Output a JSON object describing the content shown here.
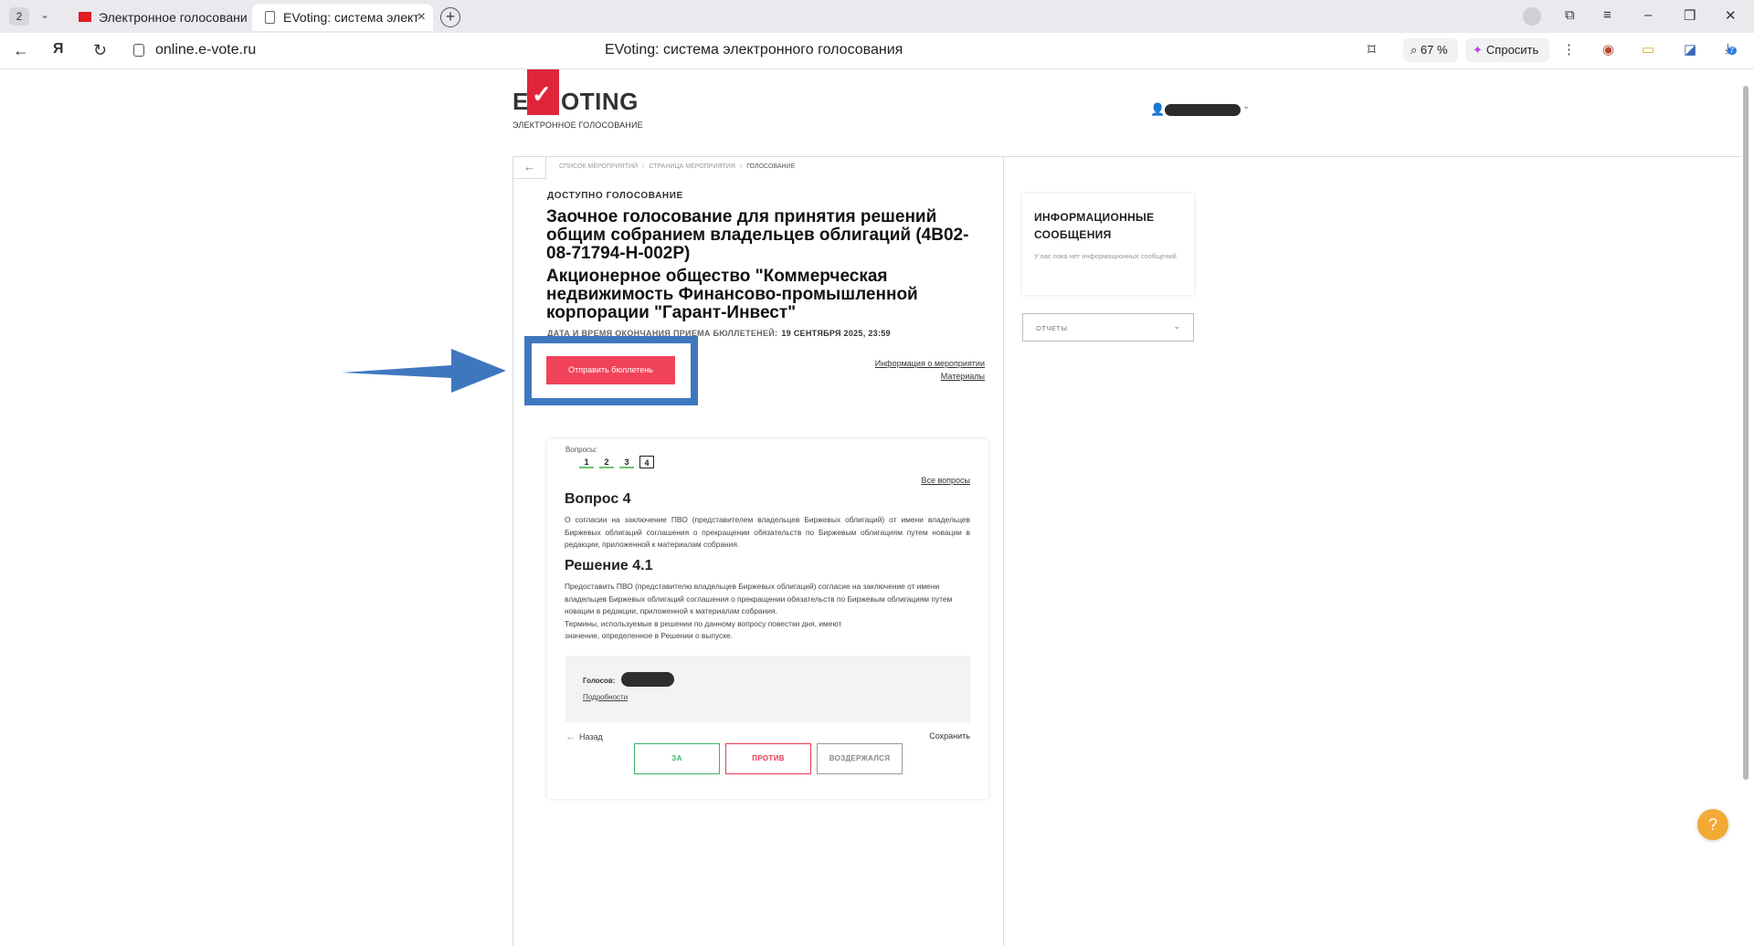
{
  "browser": {
    "tab_count": "2",
    "tabs": [
      {
        "title": "Электронное голосовани"
      },
      {
        "title": "EVoting: система элект"
      }
    ],
    "url": "online.e-vote.ru",
    "page_title": "EVoting: система электронного голосования",
    "zoom": "67 %",
    "ask_label": "Спросить",
    "download_badge": "7"
  },
  "header": {
    "logo_e": "E",
    "logo_oting": "OTING",
    "logo_sub": "ЭЛЕКТРОННОЕ ГОЛОСОВАНИЕ"
  },
  "breadcrumb": {
    "items": [
      "СПИСОК МЕРОПРИЯТИЙ",
      "СТРАНИЦА МЕРОПРИЯТИЯ",
      "ГОЛОСОВАНИЕ"
    ]
  },
  "event": {
    "status": "ДОСТУПНО ГОЛОСОВАНИЕ",
    "title": "Заочное голосование для принятия решений общим собранием владельцев облигаций (4B02-08-71794-H-002P)",
    "company": "Акционерное общество \"Коммерческая недвижимость Финансово-промышленной корпорации \"Гарант-Инвест\"",
    "deadline_label": "ДАТА И ВРЕМЯ ОКОНЧАНИЯ ПРИЕМА БЮЛЛЕТЕНЕЙ:",
    "deadline_value": "19 СЕНТЯБРЯ 2025, 23:59",
    "send_button": "Отправить бюллетень",
    "info_link": "Информация о мероприятии",
    "materials_link": "Материалы"
  },
  "questions": {
    "label": "Вопросы:",
    "numbers": [
      "1",
      "2",
      "3",
      "4"
    ],
    "active": "4",
    "all_link": "Все вопросы",
    "heading": "Вопрос 4",
    "text": "О согласии на заключение ПВО (представителем владельцев Биржевых облигаций) от имени владельцев Биржевых облигаций соглашения о прекращении обязательств по Биржевым облигациям путем новации в редакции, приложенной к материалам собрания.",
    "decision_heading": "Решение 4.1",
    "decision_text": "Предоставить ПВО (представителю владельцев Биржевых облигаций) согласие на заключение от имени владельцев Биржевых облигаций соглашения о прекращении обязательств по Биржевым облигациям путем новации в редакции, приложенной к материалам собрания.",
    "decision_text2": "Термины, используемые в решении по данному вопросу повестки дня, имеют значение, определенное в Решении о выпуске.",
    "votes_label": "Голосов:",
    "details_link": "Подробности",
    "back_label": "Назад",
    "save_label": "Сохранить",
    "vote_for": "ЗА",
    "vote_against": "ПРОТИВ",
    "vote_abstain": "ВОЗДЕРЖАЛСЯ"
  },
  "sidebar": {
    "info_title": "ИНФОРМАЦИОННЫЕ СООБЩЕНИЯ",
    "info_empty": "У вас пока нет информационных сообщений",
    "reports_label": "ОТЧЕТЫ"
  },
  "help_label": "?",
  "colors": {
    "accent_red": "#f0435a",
    "highlight_blue": "#3f77bf",
    "vote_green": "#3bb36c",
    "help_orange": "#f3a935"
  }
}
